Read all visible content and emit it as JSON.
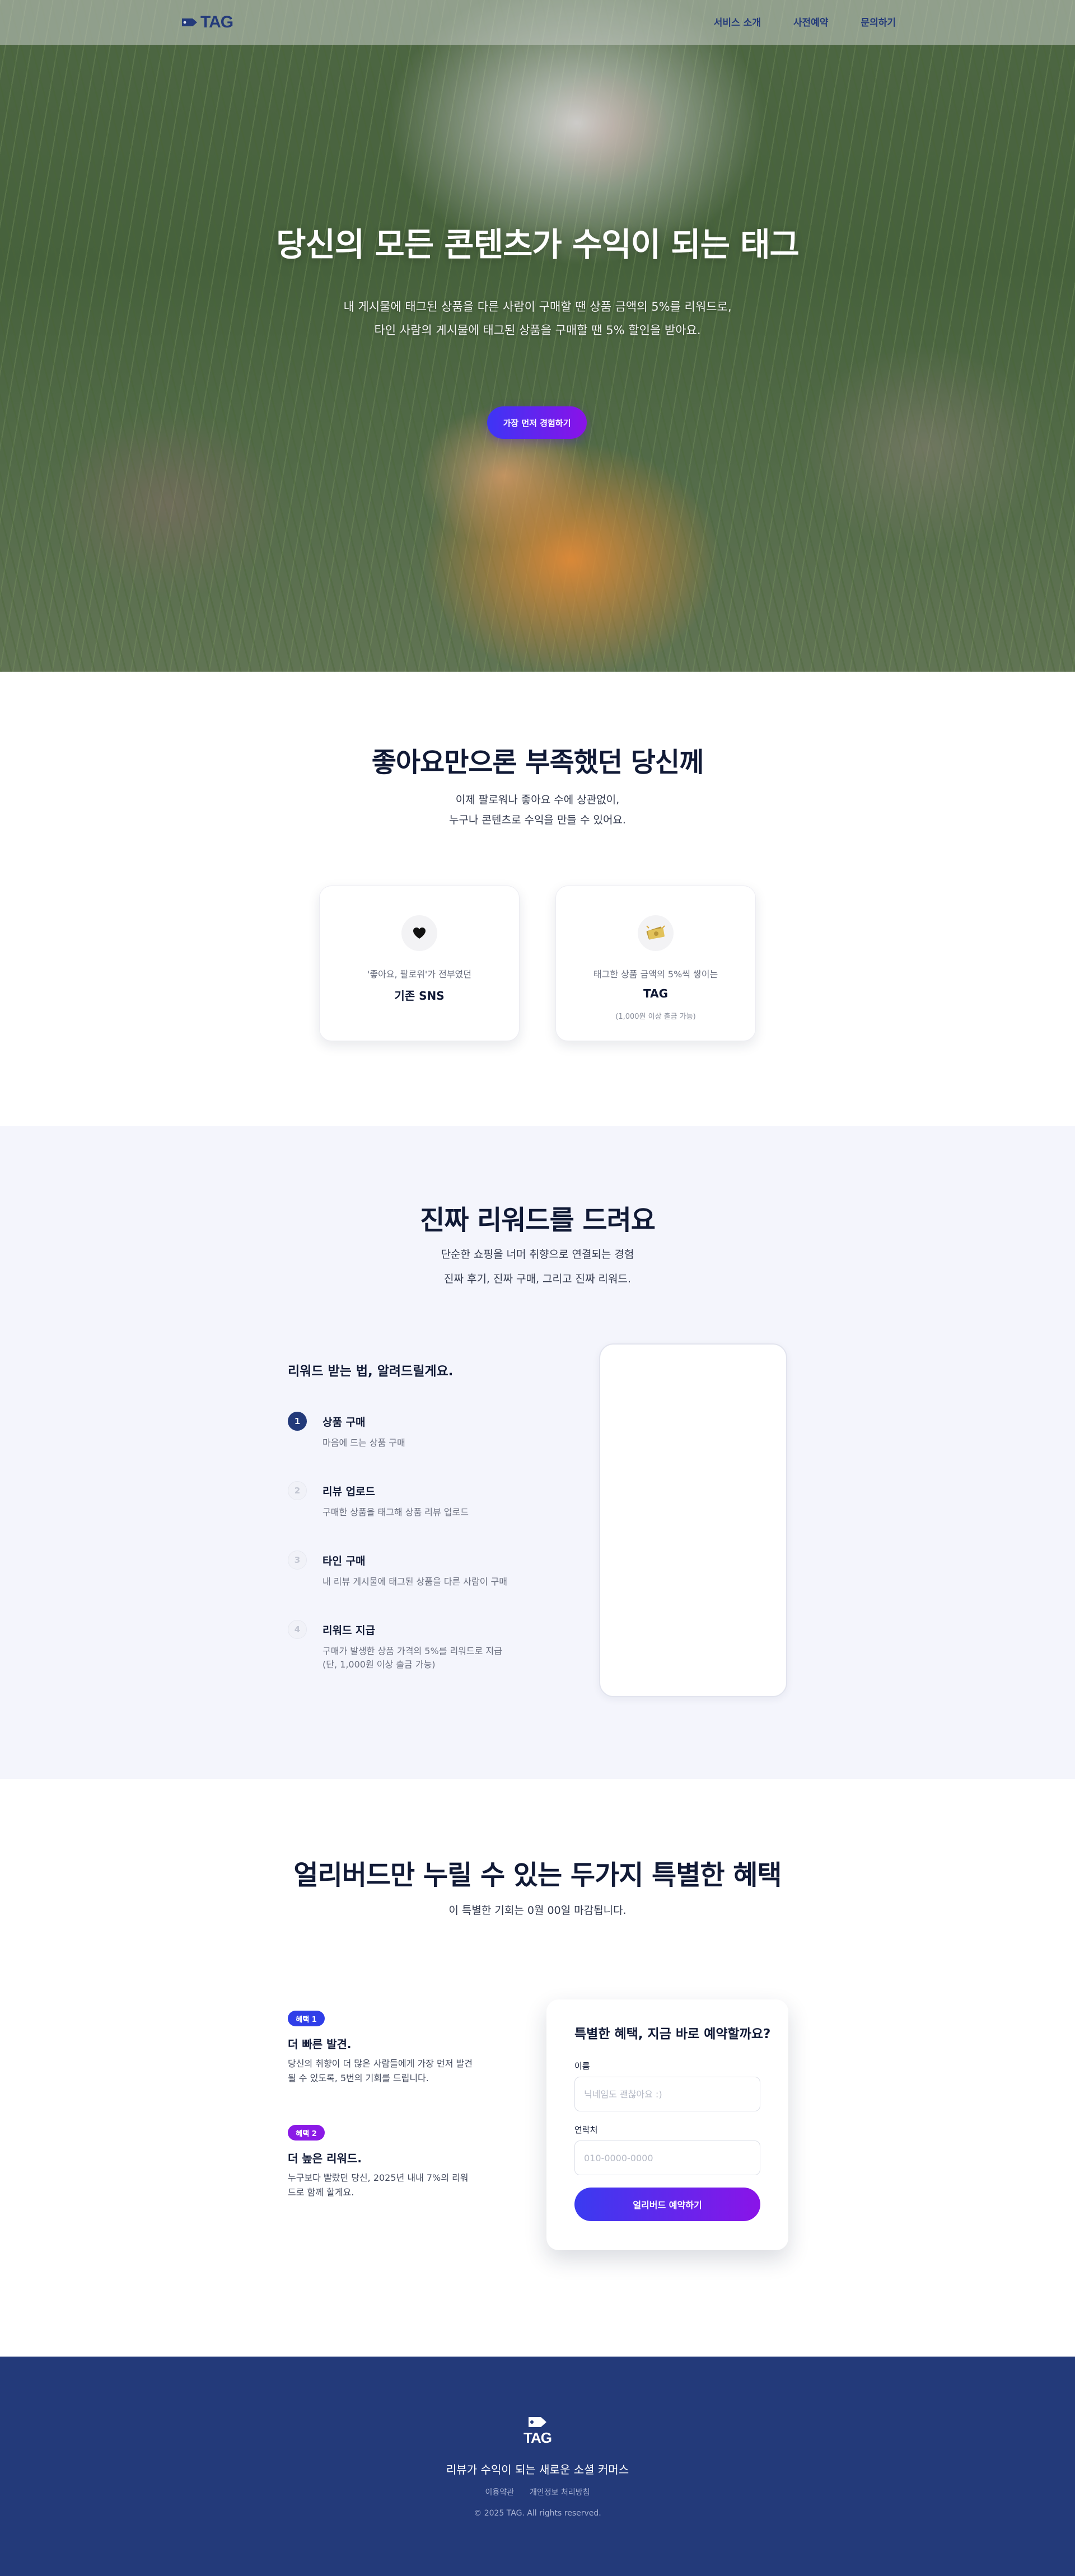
{
  "brand": {
    "logo_text": "TAG"
  },
  "nav": {
    "items": [
      {
        "label": "서비스 소개"
      },
      {
        "label": "사전예약"
      },
      {
        "label": "문의하기"
      }
    ]
  },
  "hero": {
    "title": "당신의 모든 콘텐츠가 수익이 되는 태그",
    "subtitle_line1": "내 게시물에 태그된 상품을 다른 사람이 구매할 땐 상품 금액의 5%를 리워드로,",
    "subtitle_line2": "타인 사람의 게시물에 태그된 상품을 구매할 땐 5% 할인을 받아요.",
    "cta_label": "가장 먼저 경험하기"
  },
  "compare": {
    "title": "좋아요만으론 부족했던 당신께",
    "subtitle_line1": "이제 팔로워나 좋아요 수에 상관없이,",
    "subtitle_line2": "누구나 콘텐츠로 수익을 만들 수 있어요.",
    "cards": [
      {
        "icon": "heart-icon",
        "caption": "'좋아요, 팔로워'가 전부였던",
        "title": "기존 SNS",
        "note": ""
      },
      {
        "icon": "money-icon",
        "caption": "태그한 상품 금액의 5%씩 쌓이는",
        "title": "TAG",
        "note": "(1,000원 이상 출금 가능)"
      }
    ]
  },
  "rewards": {
    "title": "진짜 리워드를 드려요",
    "subtitle_line1": "단순한 쇼핑을 너머 취향으로 연결되는 경험",
    "subtitle_line2": "진짜 후기, 진짜 구매, 그리고 진짜 리워드.",
    "steps_heading": "리워드 받는 법, 알려드릴게요.",
    "steps": [
      {
        "num": "1",
        "title": "상품 구매",
        "desc": "마음에 드는 상품 구매"
      },
      {
        "num": "2",
        "title": "리뷰 업로드",
        "desc": "구매한 상품을 태그해 상품 리뷰 업로드"
      },
      {
        "num": "3",
        "title": "타인 구매",
        "desc": "내 리뷰 게시물에 태그된 상품을 다른 사람이 구매"
      },
      {
        "num": "4",
        "title": "리워드 지급",
        "desc": "구매가 발생한 상품 가격의 5%를 리워드로 지급 (단, 1,000원 이상 출금 가능)"
      }
    ]
  },
  "earlybird": {
    "title": "얼리버드만 누릴 수 있는 두가지 특별한 혜택",
    "subtitle": "이 특별한 기회는 0월 00일 마감됩니다.",
    "benefits": [
      {
        "badge": "혜택 1",
        "title": "더 빠른 발견.",
        "desc": "당신의 취향이 더 많은 사람들에게 가장 먼저 발견될 수 있도록, 5번의 기회를 드립니다."
      },
      {
        "badge": "혜택 2",
        "title": "더 높은 리워드.",
        "desc": "누구보다 빨랐던 당신, 2025년 내내 7%의 리워드로 함께 할게요."
      }
    ],
    "form": {
      "title": "특별한 혜택, 지금 바로 예약할까요?",
      "name_label": "이름",
      "name_placeholder": "닉네임도 괜찮아요 :)",
      "phone_label": "연락처",
      "phone_placeholder": "010-0000-0000",
      "submit_label": "얼리버드 예약하기"
    }
  },
  "footer": {
    "logo_text": "TAG",
    "tagline": "리뷰가 수익이 되는 새로운 소셜 커머스",
    "links": [
      {
        "label": "이용약관"
      },
      {
        "label": "개인정보 처리방침"
      }
    ],
    "copyright": "© 2025 TAG. All rights reserved."
  },
  "colors": {
    "navy": "#233a7a",
    "section_bg": "#f4f5fc",
    "cta_gradient_start": "#3d35f5",
    "cta_gradient_end": "#8a12e8"
  }
}
